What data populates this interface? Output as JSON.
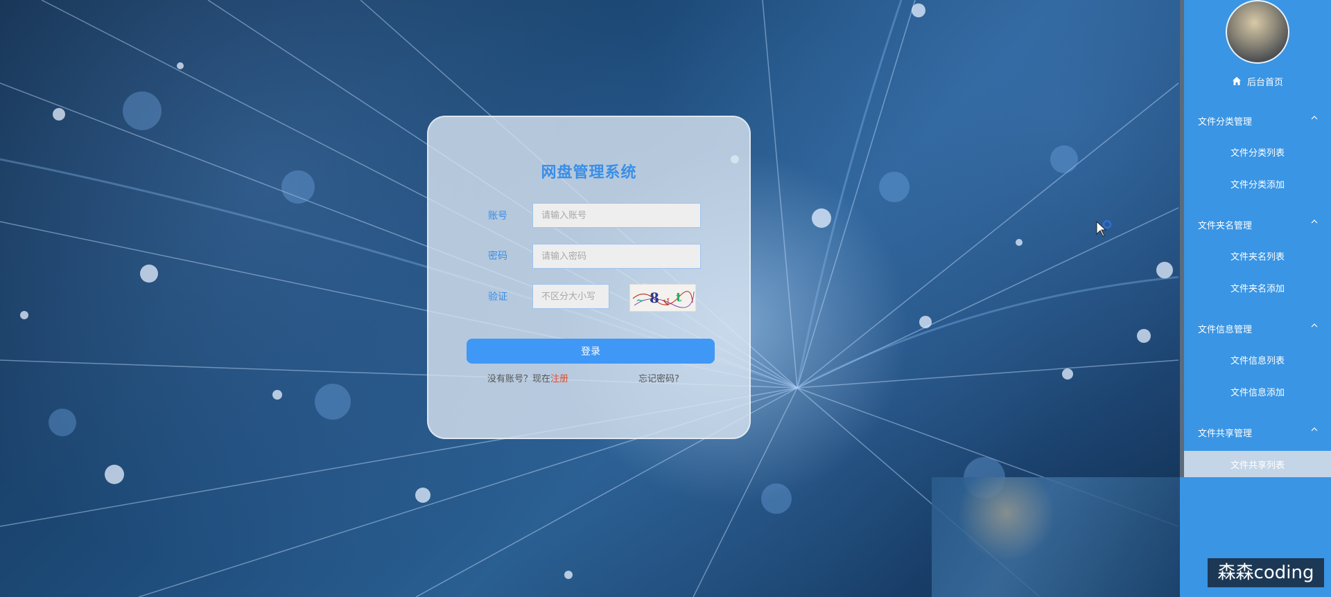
{
  "login": {
    "title": "网盘管理系统",
    "account_label": "账号",
    "account_placeholder": "请输入账号",
    "password_label": "密码",
    "password_placeholder": "请输入密码",
    "captcha_label": "验证",
    "captcha_placeholder": "不区分大小写",
    "submit_label": "登录",
    "register_prompt": "没有账号？现在",
    "register_link": "注册",
    "forgot_link": "忘记密码?"
  },
  "sidebar": {
    "home_label": "后台首页",
    "groups": [
      {
        "label": "文件分类管理",
        "items": [
          "文件分类列表",
          "文件分类添加"
        ]
      },
      {
        "label": "文件夹名管理",
        "items": [
          "文件夹名列表",
          "文件夹名添加"
        ]
      },
      {
        "label": "文件信息管理",
        "items": [
          "文件信息列表",
          "文件信息添加"
        ]
      },
      {
        "label": "文件共享管理",
        "items": [
          "文件共享列表"
        ]
      }
    ]
  },
  "watermark": "森森coding",
  "colors": {
    "accent": "#3a8ee6",
    "button": "#3f97f6",
    "sidebar_bg": "#3a95e4",
    "register_link": "#e64b2a"
  },
  "icons": [
    "home-icon",
    "chevron-up-icon",
    "captcha-image"
  ]
}
